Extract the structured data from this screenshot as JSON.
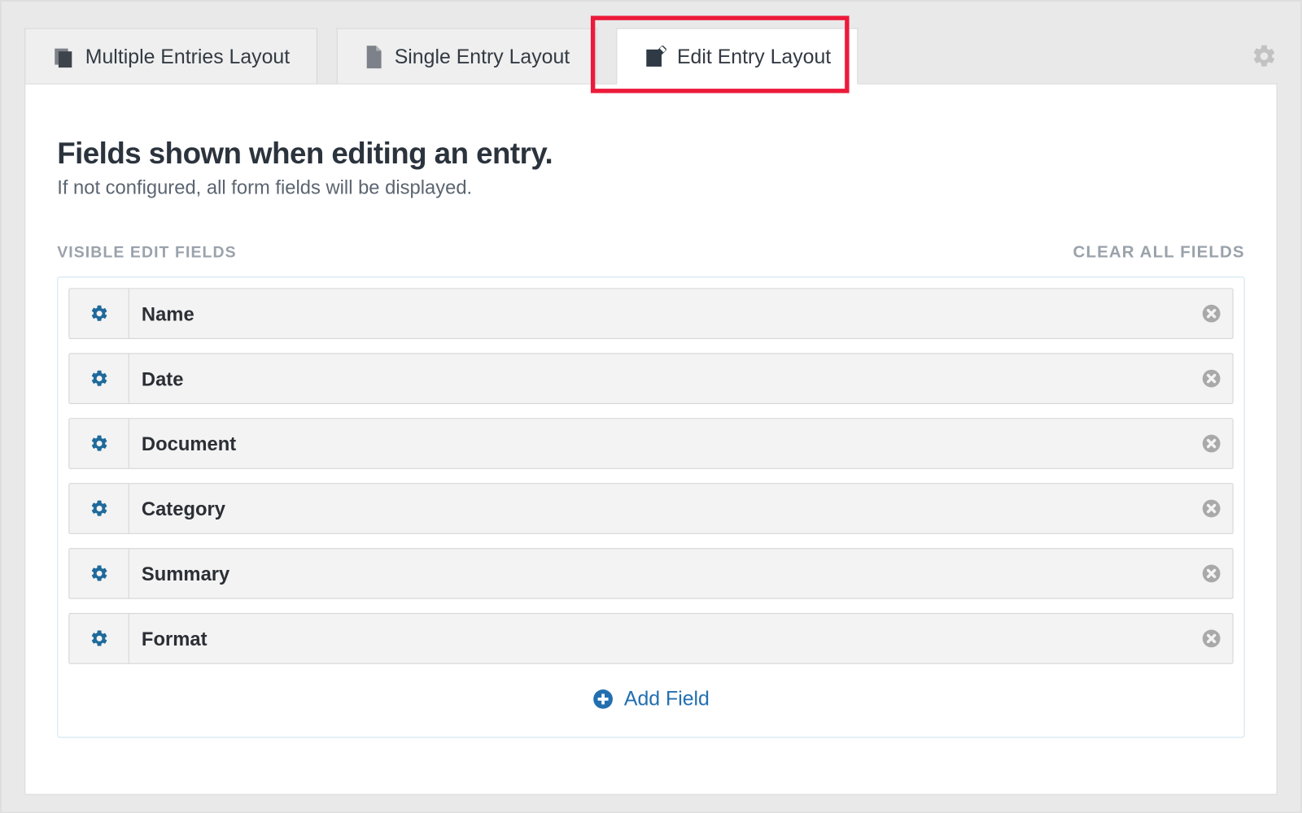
{
  "tabs": [
    {
      "label": "Multiple Entries Layout"
    },
    {
      "label": "Single Entry Layout"
    },
    {
      "label": "Edit Entry Layout"
    }
  ],
  "active_tab_index": 2,
  "heading": "Fields shown when editing an entry.",
  "subheading": "If not configured, all form fields will be displayed.",
  "section_label": "VISIBLE EDIT FIELDS",
  "clear_all_label": "CLEAR ALL FIELDS",
  "fields": [
    {
      "label": "Name"
    },
    {
      "label": "Date"
    },
    {
      "label": "Document"
    },
    {
      "label": "Category"
    },
    {
      "label": "Summary"
    },
    {
      "label": "Format"
    }
  ],
  "add_field_label": "Add Field"
}
